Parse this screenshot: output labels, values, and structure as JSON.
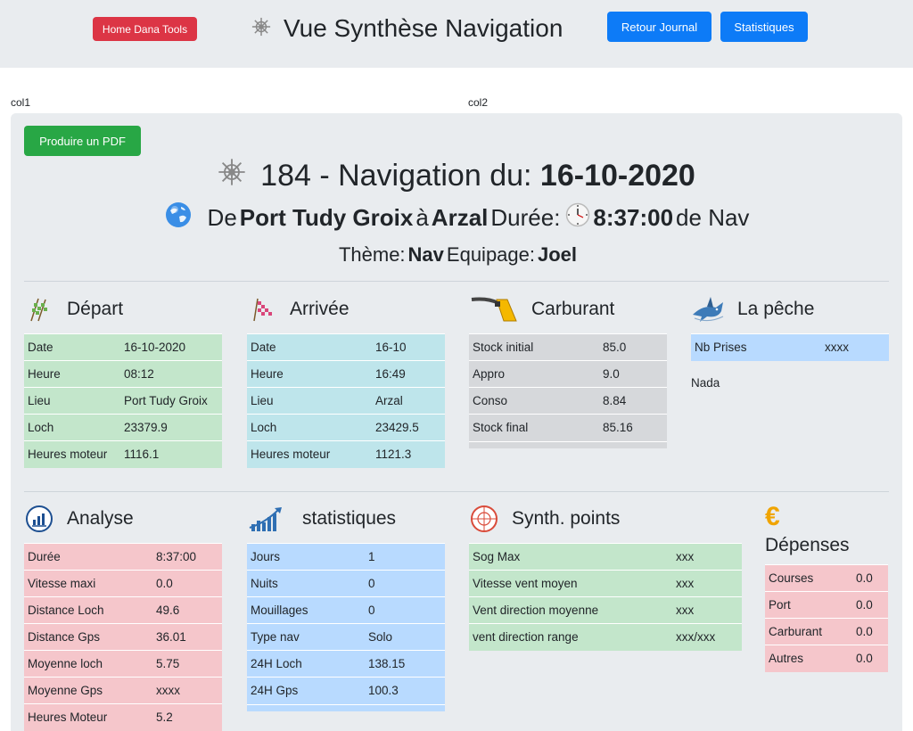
{
  "header": {
    "home_label": "Home Dana Tools",
    "title": "Vue Synthèse Navigation",
    "journal_label": "Retour Journal",
    "stats_label": "Statistiques"
  },
  "cols": {
    "col1": "col1",
    "col2": "col2"
  },
  "summary": {
    "pdf_label": "Produire un PDF",
    "nav_prefix": "184 - Navigation du:",
    "nav_date": "16-10-2020",
    "from_word": "De",
    "from_port": "Port Tudy Groix",
    "to_word": "à",
    "to_port": "Arzal",
    "duration_word": "Durée:",
    "duration": "8:37:00",
    "duration_suffix": "de Nav",
    "theme_word": "Thème:",
    "theme": "Nav",
    "crew_word": "Equipage:",
    "crew": "Joel"
  },
  "depart": {
    "title": "Départ",
    "rows": [
      [
        "Date",
        "16-10-2020"
      ],
      [
        "Heure",
        "08:12"
      ],
      [
        "Lieu",
        "Port Tudy Groix"
      ],
      [
        "Loch",
        "23379.9"
      ],
      [
        "Heures moteur",
        "1116.1"
      ]
    ]
  },
  "arrivee": {
    "title": "Arrivée",
    "rows": [
      [
        "Date",
        "16-10"
      ],
      [
        "Heure",
        "16:49"
      ],
      [
        "Lieu",
        "Arzal"
      ],
      [
        "Loch",
        "23429.5"
      ],
      [
        "Heures moteur",
        "1121.3"
      ]
    ]
  },
  "carburant": {
    "title": "Carburant",
    "rows": [
      [
        "Stock initial",
        "85.0"
      ],
      [
        "Appro",
        "9.0"
      ],
      [
        "Conso",
        "8.84"
      ],
      [
        "Stock final",
        "85.16"
      ]
    ]
  },
  "peche": {
    "title": "La pêche",
    "rows": [
      [
        "Nb Prises",
        "xxxx"
      ]
    ],
    "note": "Nada"
  },
  "analyse": {
    "title": "Analyse",
    "rows": [
      [
        "Durée",
        "8:37:00"
      ],
      [
        "Vitesse maxi",
        "0.0"
      ],
      [
        "Distance Loch",
        "49.6"
      ],
      [
        "Distance Gps",
        "36.01"
      ],
      [
        "Moyenne loch",
        "5.75"
      ],
      [
        "Moyenne Gps",
        "xxxx"
      ],
      [
        "Heures Moteur",
        "5.2"
      ]
    ]
  },
  "statistiques": {
    "title": "statistiques",
    "rows": [
      [
        "Jours",
        "1"
      ],
      [
        "Nuits",
        "0"
      ],
      [
        "Mouillages",
        "0"
      ],
      [
        "Type nav",
        "Solo"
      ],
      [
        "24H Loch",
        "138.15"
      ],
      [
        "24H Gps",
        "100.3"
      ]
    ]
  },
  "synth": {
    "title": "Synth. points",
    "rows": [
      [
        "Sog Max",
        "xxx"
      ],
      [
        "Vitesse vent moyen",
        "xxx"
      ],
      [
        "Vent direction moyenne",
        "xxx"
      ],
      [
        "vent direction range",
        "xxx/xxx"
      ]
    ]
  },
  "depenses": {
    "title": "Dépenses",
    "rows": [
      [
        "Courses",
        "0.0"
      ],
      [
        "Port",
        "0.0"
      ],
      [
        "Carburant",
        "0.0"
      ],
      [
        "Autres",
        "0.0"
      ]
    ]
  },
  "colors": {
    "red_button": "#dc3545",
    "blue_button": "#0d7bf7",
    "green_button": "#28a745",
    "green_table": "#c3e6cb",
    "cyan_table": "#bee5eb",
    "grey_table": "#d6d8db",
    "blue_table": "#b8daff",
    "red_table": "#f5c6cb"
  }
}
